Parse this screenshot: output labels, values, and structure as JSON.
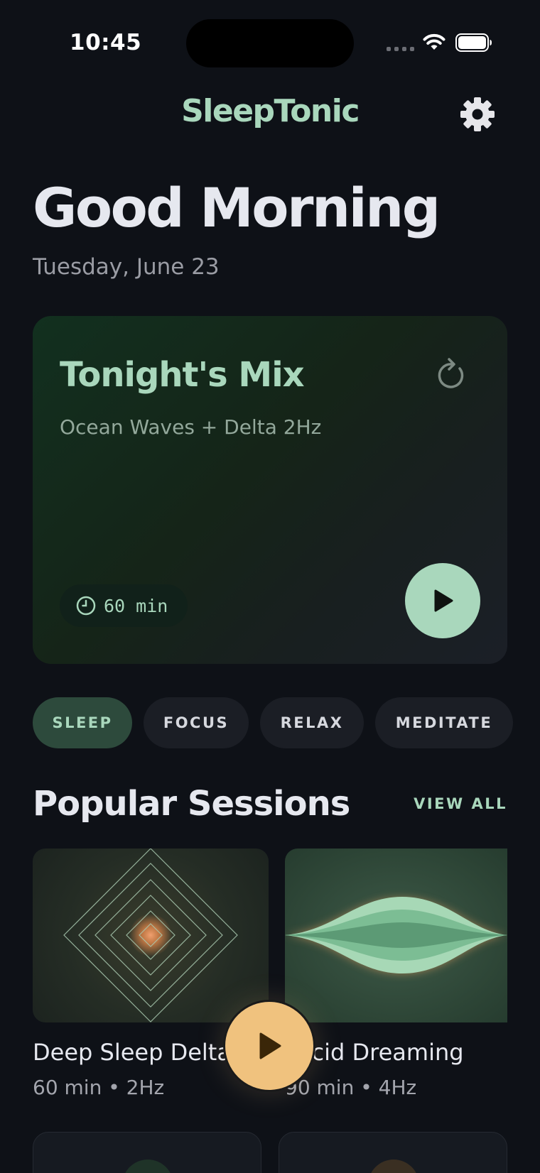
{
  "status_bar": {
    "time": "10:45"
  },
  "header": {
    "app_title": "SleepTonic",
    "settings_icon": "gear-icon"
  },
  "greeting": {
    "title": "Good Morning",
    "date": "Tuesday, June 23"
  },
  "tonight_mix": {
    "title": "Tonight's Mix",
    "subtitle": "Ocean Waves + Delta 2Hz",
    "duration": "60 min",
    "refresh_icon": "refresh-icon",
    "play_icon": "play-icon"
  },
  "categories": [
    {
      "label": "SLEEP",
      "active": true
    },
    {
      "label": "FOCUS",
      "active": false
    },
    {
      "label": "RELAX",
      "active": false
    },
    {
      "label": "MEDITATE",
      "active": false
    }
  ],
  "popular": {
    "title": "Popular Sessions",
    "view_all": "VIEW ALL",
    "sessions": [
      {
        "name": "Deep Sleep Delta",
        "meta": "60 min • 2Hz"
      },
      {
        "name": "Lucid Dreaming",
        "meta": "90 min • 4Hz"
      }
    ]
  },
  "colors": {
    "background": "#0e1117",
    "accent_green": "#a9d7bc",
    "accent_orange": "#f0c27e",
    "pill_active": "#2d4a3c"
  }
}
